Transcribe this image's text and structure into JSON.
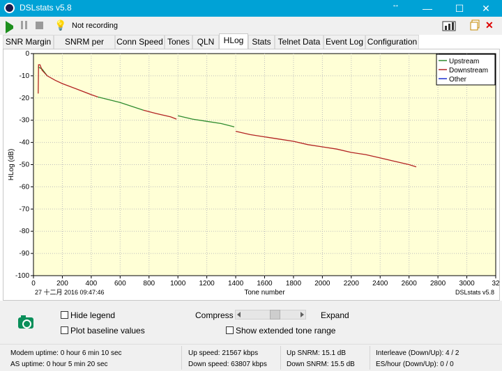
{
  "window": {
    "title": "DSLstats v5.8"
  },
  "toolbar": {
    "status": "Not recording"
  },
  "tabs": [
    "SNR Margin",
    "SNRM per Band",
    "Conn Speed",
    "Tones",
    "QLN",
    "HLog",
    "Stats",
    "Telnet Data",
    "Event Log",
    "Configuration"
  ],
  "plot": {
    "footer_left": "27 十二月 2016 09:47:46",
    "footer_right": "DSLstats v5.8"
  },
  "chart_data": {
    "type": "line",
    "xlabel": "Tone number",
    "ylabel": "HLog (dB)",
    "xlim": [
      0,
      3200
    ],
    "ylim": [
      -100,
      0
    ],
    "x_ticks": [
      "0",
      "200",
      "400",
      "600",
      "800",
      "1000",
      "1200",
      "1400",
      "1600",
      "1800",
      "2000",
      "2200",
      "2400",
      "2600",
      "2800",
      "3000",
      "32"
    ],
    "y_ticks": [
      "0",
      "-10",
      "-20",
      "-30",
      "-40",
      "-50",
      "-60",
      "-70",
      "-80",
      "-90",
      "-100"
    ],
    "grid": true,
    "legend_position": "top-right",
    "background": "#ffffd6",
    "series": [
      {
        "name": "Upstream",
        "color": "#2e8b2e",
        "segments": [
          [
            [
              32,
              -6
            ],
            [
              60,
              -7
            ],
            [
              95,
              -10
            ]
          ],
          [
            [
              445,
              -19.5
            ],
            [
              600,
              -22
            ],
            [
              760,
              -25.5
            ]
          ],
          [
            [
              1000,
              -28
            ],
            [
              1100,
              -29.5
            ],
            [
              1200,
              -30.5
            ],
            [
              1300,
              -31.5
            ],
            [
              1390,
              -33
            ]
          ]
        ]
      },
      {
        "name": "Downstream",
        "color": "#b22222",
        "segments": [
          [
            [
              33,
              -18
            ],
            [
              35,
              -5
            ],
            [
              45,
              -5
            ],
            [
              60,
              -7.5
            ],
            [
              95,
              -10
            ],
            [
              150,
              -12
            ],
            [
              200,
              -13.5
            ],
            [
              300,
              -16
            ],
            [
              400,
              -18.5
            ],
            [
              445,
              -19.5
            ]
          ],
          [
            [
              760,
              -25.5
            ],
            [
              850,
              -27
            ],
            [
              950,
              -28.5
            ],
            [
              990,
              -29.5
            ]
          ],
          [
            [
              1400,
              -35
            ],
            [
              1500,
              -36.5
            ],
            [
              1600,
              -37.5
            ],
            [
              1700,
              -38.5
            ],
            [
              1800,
              -39.5
            ],
            [
              1900,
              -41
            ],
            [
              2000,
              -42
            ],
            [
              2100,
              -43
            ],
            [
              2200,
              -44.5
            ],
            [
              2300,
              -45.5
            ],
            [
              2400,
              -47
            ],
            [
              2500,
              -48.5
            ],
            [
              2600,
              -50
            ],
            [
              2650,
              -51
            ]
          ]
        ]
      },
      {
        "name": "Other",
        "color": "#1c2fd0",
        "segments": []
      }
    ]
  },
  "options": {
    "hide_legend": "Hide legend",
    "plot_baseline": "Plot baseline values",
    "compress": "Compress",
    "expand": "Expand",
    "extended_range": "Show extended tone range"
  },
  "status": {
    "modem_uptime": "Modem uptime:  0 hour 6 min 10 sec",
    "as_uptime": "AS uptime:  0 hour 5 min 20 sec",
    "up_speed": "Up speed: 21567 kbps",
    "down_speed": "Down speed: 63807 kbps",
    "up_snrm": "Up SNRM: 15.1 dB",
    "down_snrm": "Down SNRM: 15.5 dB",
    "interleave": "Interleave (Down/Up): 4 / 2",
    "es_hour": "ES/hour (Down/Up): 0 / 0"
  }
}
